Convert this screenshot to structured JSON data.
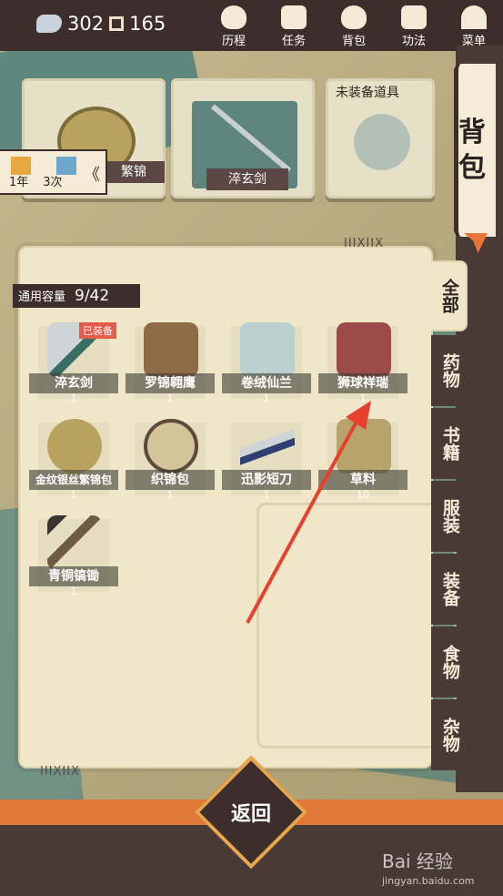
{
  "topbar": {
    "currency_a": "302",
    "currency_b": "165",
    "nav": [
      {
        "label": "历程",
        "icon": "journey-icon"
      },
      {
        "label": "任务",
        "icon": "task-icon"
      },
      {
        "label": "背包",
        "icon": "backpack-icon"
      },
      {
        "label": "功法",
        "icon": "skills-icon"
      },
      {
        "label": "菜单",
        "icon": "menu-fan-icon"
      }
    ]
  },
  "side_title": "背包",
  "equipped_slots": [
    {
      "label": "繁锦"
    },
    {
      "label": "淬玄剑"
    },
    {
      "label": "未装备道具"
    }
  ],
  "buff": {
    "a": "1年",
    "b": "3次",
    "chevron": "《"
  },
  "capacity": {
    "label": "通用容量",
    "value": "9/42"
  },
  "marks": {
    "top": "IIIXIIX",
    "bottom": "IIIXIIX"
  },
  "items": [
    {
      "name": "淬玄剑",
      "qty": "1",
      "equipped": "已装备"
    },
    {
      "name": "罗锦翱鹰",
      "qty": "1"
    },
    {
      "name": "卷绒仙兰",
      "qty": "1"
    },
    {
      "name": "狮球祥瑞",
      "qty": "1"
    },
    {
      "name": "金纹银丝繁锦包",
      "qty": "1"
    },
    {
      "name": "织锦包",
      "qty": "1"
    },
    {
      "name": "迅影短刀",
      "qty": "1"
    },
    {
      "name": "草料",
      "qty": "10"
    },
    {
      "name": "青铜镐锄",
      "qty": "1"
    }
  ],
  "tabs": [
    {
      "label": "全部"
    },
    {
      "label": "药物"
    },
    {
      "label": "书籍"
    },
    {
      "label": "服装"
    },
    {
      "label": "装备"
    },
    {
      "label": "食物"
    },
    {
      "label": "杂物"
    }
  ],
  "back_label": "返回",
  "watermark": {
    "brand": "Bai 经验",
    "url": "jingyan.baidu.com"
  },
  "colors": {
    "accent_orange": "#e07839",
    "dark": "#3d2e2c",
    "parchment": "#f0e7c9",
    "teal": "#4e7f7b"
  }
}
